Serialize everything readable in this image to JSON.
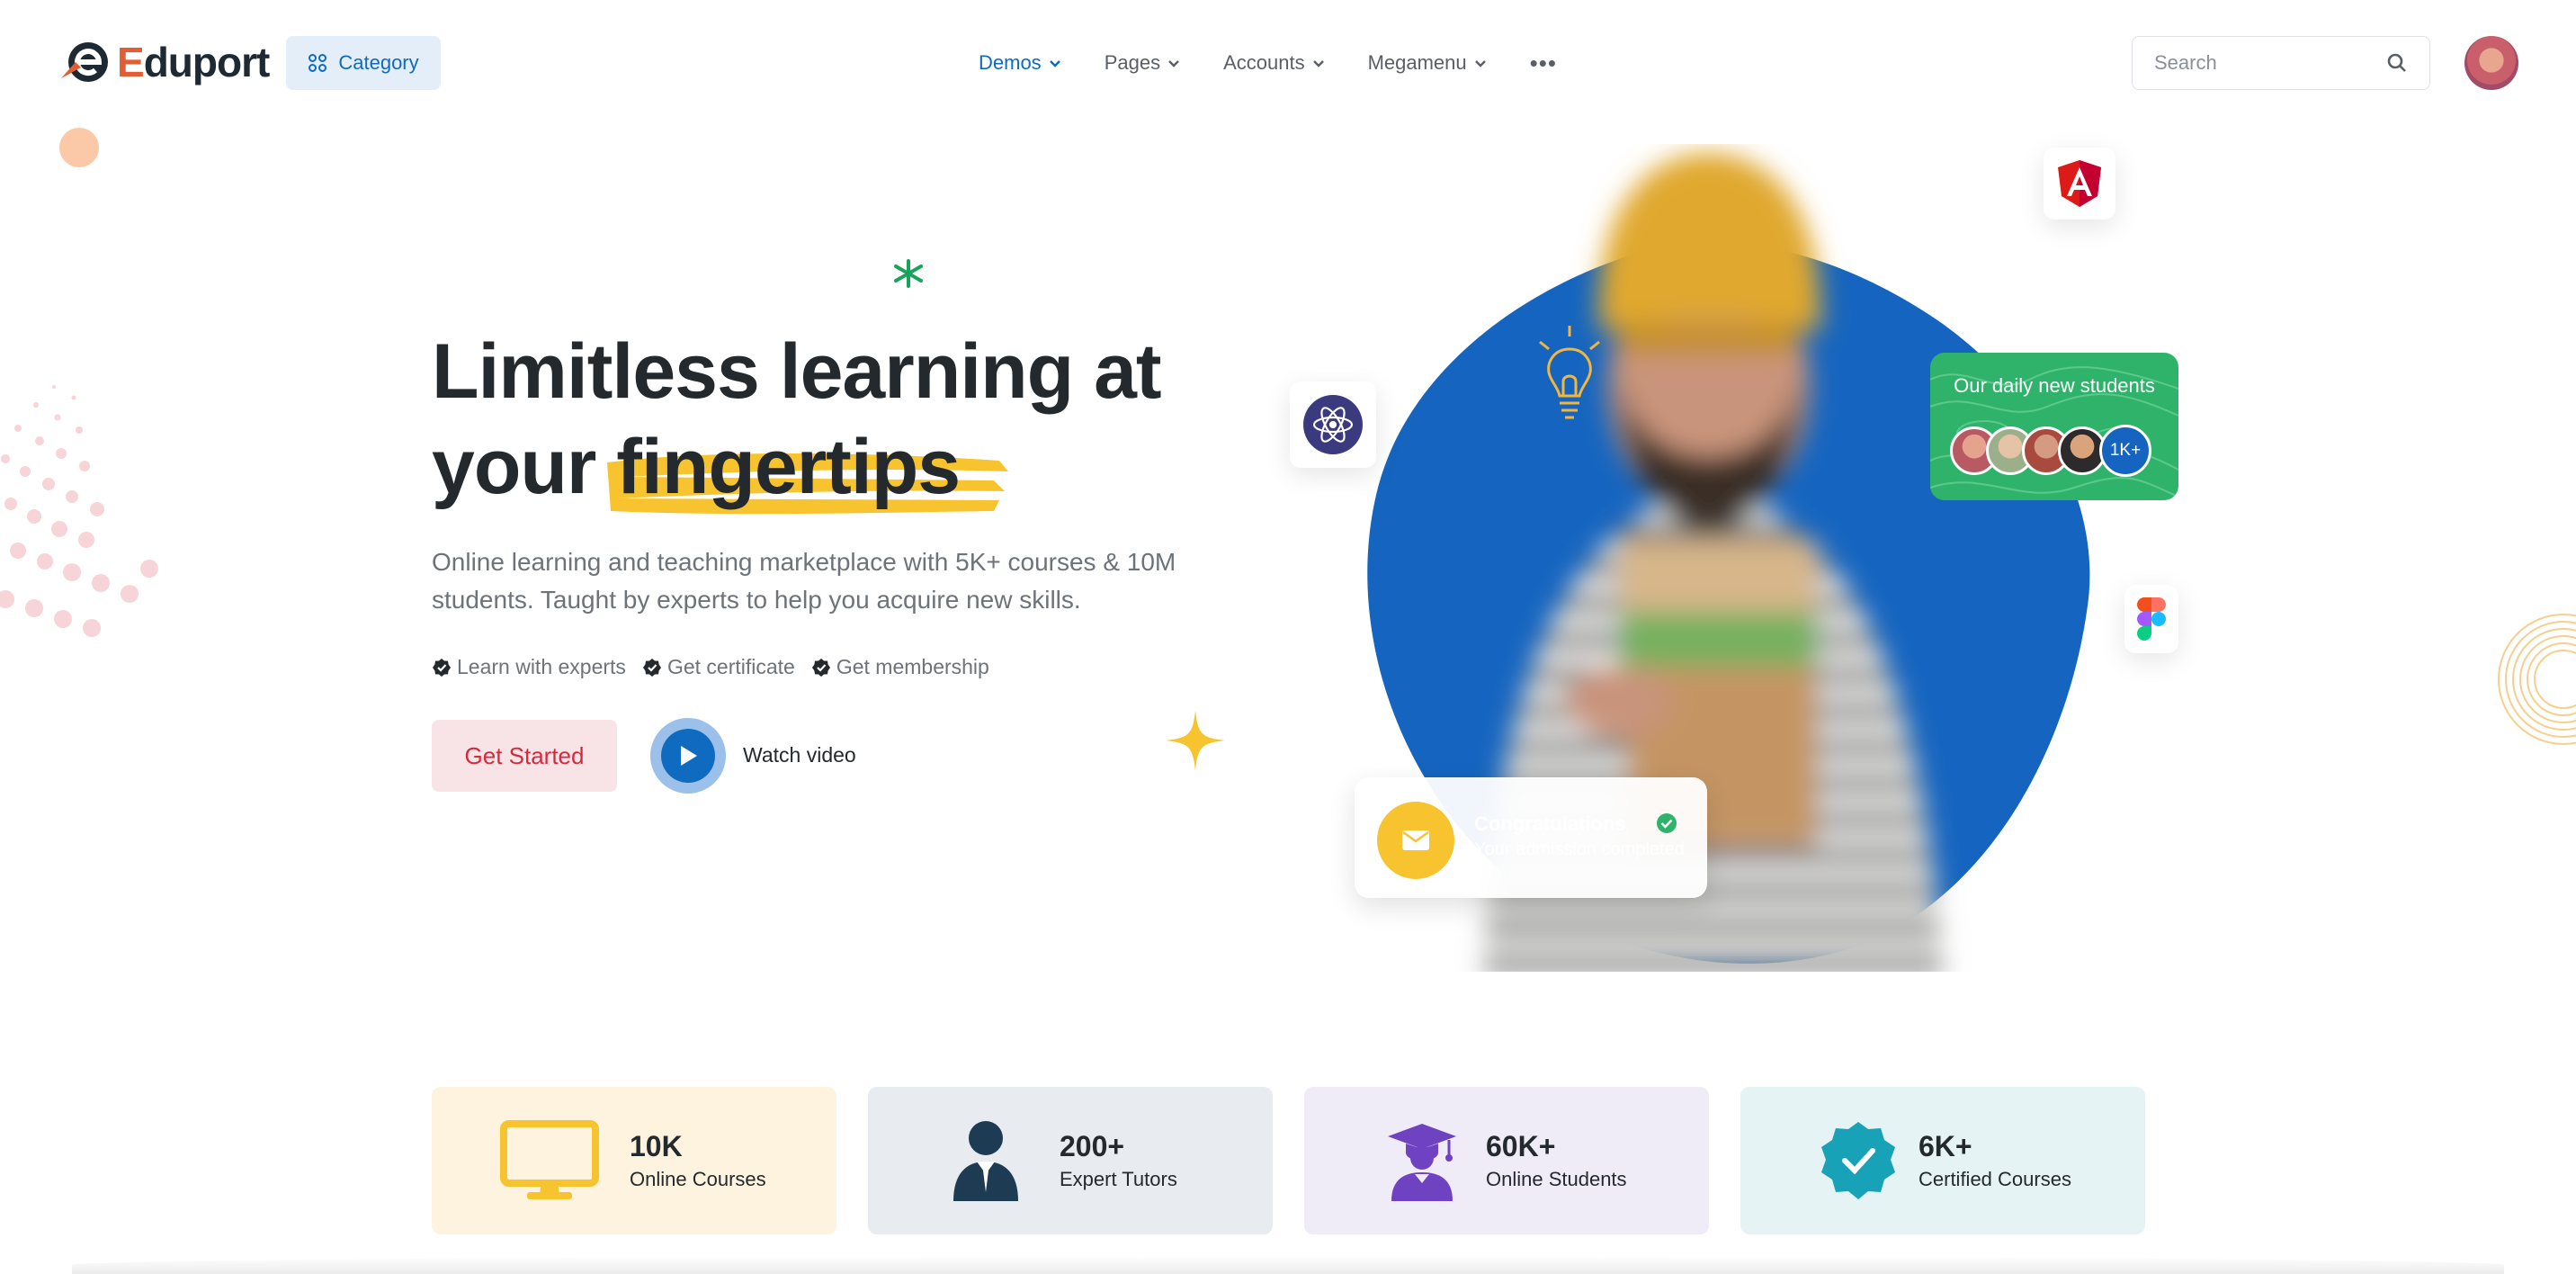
{
  "brand": {
    "name_first": "E",
    "name_rest": "duport"
  },
  "header": {
    "category_label": "Category",
    "nav": [
      {
        "label": "Demos",
        "active": true
      },
      {
        "label": "Pages",
        "active": false
      },
      {
        "label": "Accounts",
        "active": false
      },
      {
        "label": "Megamenu",
        "active": false
      }
    ],
    "more_label": "•••",
    "search_placeholder": "Search"
  },
  "hero": {
    "title_line1": "Limitless learning at",
    "title_word": "your",
    "title_highlight": "fingertips",
    "lead": "Online learning and teaching marketplace with 5K+ courses & 10M students. Taught by experts to help you acquire new skills.",
    "features": [
      "Learn with experts",
      "Get certificate",
      "Get membership"
    ],
    "cta_label": "Get Started",
    "video_label": "Watch video"
  },
  "students_card": {
    "title": "Our daily new students",
    "count": "1K+"
  },
  "congrats_card": {
    "title": "Congratulations",
    "subtitle": "Your admission completed"
  },
  "stats": [
    {
      "value": "10K",
      "label": "Online Courses",
      "icon": "monitor-icon",
      "bg": "#fdf3de",
      "color": "#f7c32e"
    },
    {
      "value": "200+",
      "label": "Expert Tutors",
      "icon": "tutor-icon",
      "bg": "#e8ebef",
      "color": "#1d3b53"
    },
    {
      "value": "60K+",
      "label": "Online Students",
      "icon": "graduate-icon",
      "bg": "#efebf7",
      "color": "#6f42c1"
    },
    {
      "value": "6K+",
      "label": "Certified Courses",
      "icon": "certificate-badge-icon",
      "bg": "#e5f3f5",
      "color": "#17a2b8"
    }
  ],
  "colors": {
    "primary": "#0f6bbf",
    "danger": "#d6293e",
    "warning": "#f7c32e",
    "success": "#2fb36a"
  }
}
